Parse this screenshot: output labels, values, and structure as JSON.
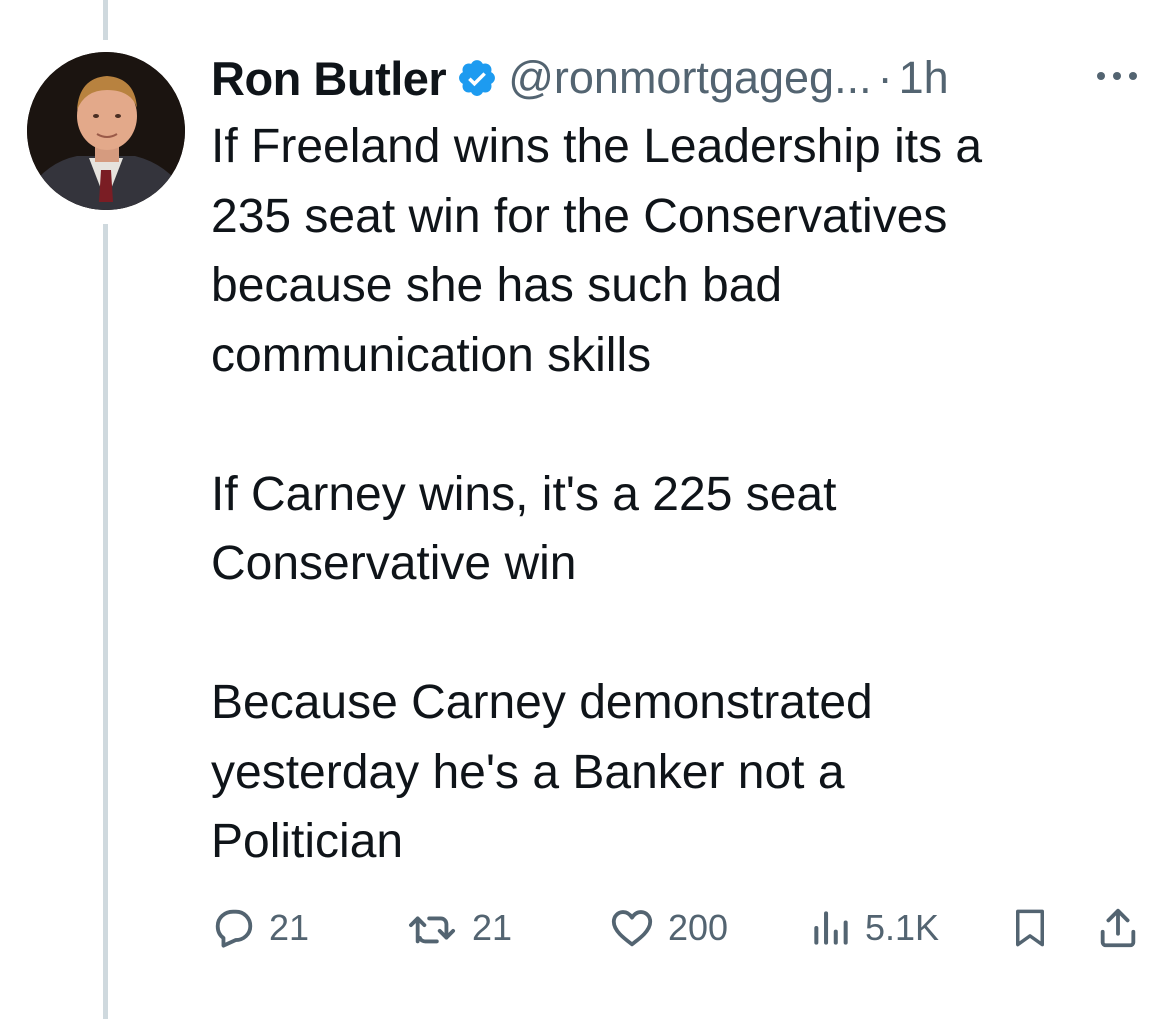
{
  "tweet": {
    "author_name": "Ron Butler",
    "handle": "@ronmortgageg...",
    "separator": "·",
    "time": "1h",
    "paragraphs": [
      "If Freeland wins the Leadership its a\n235 seat win for the Conservatives\nbecause she has such bad\ncommunication skills",
      "If Carney wins, it's a 225 seat\nConservative win",
      "Because Carney demonstrated\nyesterday he's a Banker not a\nPolitician"
    ]
  },
  "actions": {
    "replies": "21",
    "reposts": "21",
    "likes": "200",
    "views": "5.1K"
  },
  "icons": {
    "verified": "verified-badge-icon",
    "more": "more-icon",
    "reply": "reply-icon",
    "repost": "repost-icon",
    "like": "heart-icon",
    "views": "views-icon",
    "bookmark": "bookmark-icon",
    "share": "share-icon"
  },
  "colors": {
    "text": "#0f1419",
    "secondary": "#536471",
    "verified": "#1d9bf0",
    "thread_line": "#cfd9de"
  }
}
